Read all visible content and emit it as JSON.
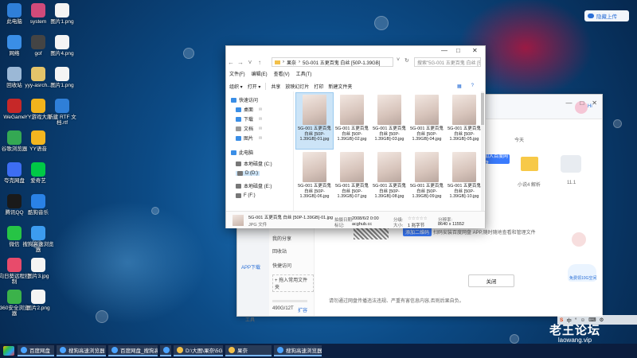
{
  "desktop_icons": [
    {
      "label": "此电脑",
      "color": "#2f7fd8"
    },
    {
      "label": "system",
      "color": "#d04a7a"
    },
    {
      "label": "图片1.png",
      "color": "#f4f4f4"
    },
    {
      "label": "网络",
      "color": "#3a8ee6"
    },
    {
      "label": "gof",
      "color": "#444"
    },
    {
      "label": "图片4.png",
      "color": "#f4f4f4"
    },
    {
      "label": "回收站",
      "color": "#9bb8d6"
    },
    {
      "label": "yyy-asrch...",
      "color": "#e4c46a"
    },
    {
      "label": "图片1.png",
      "color": "#f4f4f4"
    },
    {
      "label": "WeGame",
      "color": "#c62828"
    },
    {
      "label": "YY游戏大厅",
      "color": "#f1b31c"
    },
    {
      "label": "新建 RTF 文档.rtf",
      "color": "#2f7fd8"
    },
    {
      "label": "谷歌浏览器",
      "color": "#34a853"
    },
    {
      "label": "YY语音",
      "color": "#f3b51f"
    },
    {
      "label": "",
      "color": ""
    },
    {
      "label": "夸克网盘",
      "color": "#3d6df2"
    },
    {
      "label": "爱奇艺",
      "color": "#00c846"
    },
    {
      "label": "",
      "color": ""
    },
    {
      "label": "腾讯QQ",
      "color": "#1a1a1a"
    },
    {
      "label": "酷狗音乐",
      "color": "#2a82e6"
    },
    {
      "label": "",
      "color": ""
    },
    {
      "label": "微信",
      "color": "#26c445"
    },
    {
      "label": "搜狗高速浏览器",
      "color": "#3c9cf0"
    },
    {
      "label": "",
      "color": ""
    },
    {
      "label": "向日葵远程控制",
      "color": "#e84b6b"
    },
    {
      "label": "图片3.jpg",
      "color": "#f4f4f4"
    },
    {
      "label": "",
      "color": ""
    },
    {
      "label": "360安全浏览器",
      "color": "#3bb24a"
    },
    {
      "label": "图片2.png",
      "color": "#f4f4f4"
    }
  ],
  "top_pill": {
    "label": "隐藏上传"
  },
  "explorer": {
    "address": [
      "果奈",
      "5G-001 五更百鬼 白丝 [50P-1.39GB]"
    ],
    "search_placeholder": "搜索\"5G-001 五更百鬼 白丝 [50P-1.39G...",
    "menu": [
      "文件(F)",
      "编辑(E)",
      "查看(V)",
      "工具(T)"
    ],
    "commands": [
      "组织 ▾",
      "打开 ▾",
      "共享",
      "放映幻灯片",
      "打印",
      "新建文件夹"
    ],
    "tree": [
      {
        "label": "快速访问",
        "color": "#3a8ee6",
        "pin": false
      },
      {
        "label": "桌面",
        "color": "#3a8ee6",
        "pin": true
      },
      {
        "label": "下载",
        "color": "#3a8ee6",
        "pin": true
      },
      {
        "label": "文档",
        "color": "#999",
        "pin": true
      },
      {
        "label": "图片",
        "color": "#3a8ee6",
        "pin": true
      },
      {
        "label": "此电脑",
        "color": "#3a8ee6",
        "pin": false
      },
      {
        "label": "本地磁盘 (C:)",
        "color": "#777",
        "pin": false
      },
      {
        "label": "D (D:)",
        "color": "#777",
        "pin": false
      },
      {
        "label": "本地磁盘 (E:)",
        "color": "#777",
        "pin": false
      },
      {
        "label": "F (F:)",
        "color": "#777",
        "pin": false
      }
    ],
    "files": [
      "5G-001 五更百鬼 白丝 [50P-1.39GB]-01.jpg",
      "5G-001 五更百鬼 白丝 [50P-1.39GB]-02.jpg",
      "5G-001 五更百鬼 白丝 [50P-1.39GB]-03.jpg",
      "5G-001 五更百鬼 白丝 [50P-1.39GB]-04.jpg",
      "5G-001 五更百鬼 白丝 [50P-1.39GB]-05.jpg",
      "5G-001 五更百鬼 白丝 [50P-1.39GB]-06.jpg",
      "5G-001 五更百鬼 白丝 [50P-1.39GB]-07.jpg",
      "5G-001 五更百鬼 白丝 [50P-1.39GB]-08.jpg",
      "5G-001 五更百鬼 白丝 [50P-1.39GB]-09.jpg",
      "5G-001 五更百鬼 白丝 [50P-1.39GB]-10.jpg"
    ],
    "details": {
      "name": "5G-001 五更百鬼 白丝 [50P-1.39GB]-01.jpg",
      "type": "JPG 文件",
      "date_label": "拍摄日期:",
      "date_value": "2008/6/2 0:00",
      "tag_label": "标记:",
      "tag_value": "acghub.cc",
      "rating_label": "分级:",
      "rating_value": "☆☆☆☆☆",
      "size_label": "大小:",
      "size_value": "1 兆字节",
      "dims_label": "分辨率:",
      "dims_value": "8640 x 11552"
    }
  },
  "bg_app": {
    "left_items": [
      "我的分享",
      "回收站",
      "快捷访问",
      "+ 拖入常用文件夹"
    ],
    "side_labels": [
      "APP下载",
      "工具"
    ],
    "storage": "490G/12T",
    "storage_action": "扩容",
    "folder_labels": [
      "",
      "小说4 解析",
      "11.1"
    ],
    "right_label": "今天",
    "blue_btn": "加入百度网盘",
    "upload_btn": "添加二维码",
    "hint": "扫码安装百度网盘 APP,随时随地查看和管理文件",
    "close_label": "关闭",
    "footer": "请勿通过网盘传播违法违规、严重有害信息内容,否则后果自负。",
    "avatar_text": "Hi"
  },
  "bubble_text": "免费领10G空间",
  "tray": [
    "S",
    "中",
    "°",
    "☺",
    "⌨",
    "⚙"
  ],
  "watermark": {
    "title": "老王论坛",
    "url": "laowang.vip"
  },
  "taskbar": [
    {
      "label": "百度网盘"
    },
    {
      "label": "搜狗高速浏览器 - [收藏..."
    },
    {
      "label": "百度网盘_搜狗高速浏..."
    },
    {
      "label": ""
    },
    {
      "label": "D:\\大图\\果奈\\5G-0..."
    },
    {
      "label": "果奈"
    },
    {
      "label": "搜狗高速浏览器(3)"
    }
  ]
}
